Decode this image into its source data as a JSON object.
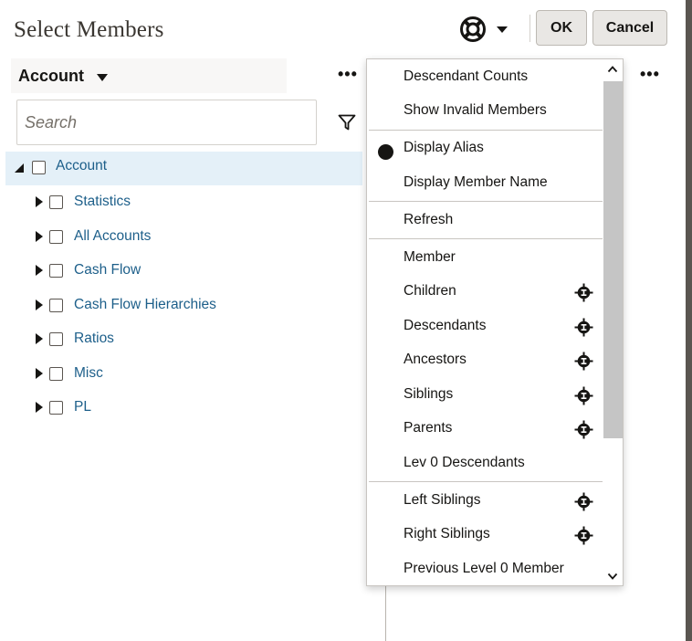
{
  "dialog": {
    "title": "Select Members",
    "ok_label": "OK",
    "cancel_label": "Cancel",
    "help_icon": "lifebuoy-icon"
  },
  "dimension": {
    "selected": "Account"
  },
  "search": {
    "placeholder": "Search",
    "value": ""
  },
  "tree": {
    "root": {
      "label": "Account",
      "expanded": true,
      "checked": false
    },
    "children": [
      {
        "label": "Statistics"
      },
      {
        "label": "All Accounts"
      },
      {
        "label": "Cash Flow"
      },
      {
        "label": "Cash Flow Hierarchies"
      },
      {
        "label": "Ratios"
      },
      {
        "label": "Misc"
      },
      {
        "label": "PL"
      }
    ]
  },
  "menu": {
    "items": [
      {
        "label": "Descendant Counts"
      },
      {
        "label": "Show Invalid Members"
      },
      {
        "label": "Display Alias",
        "selected": true
      },
      {
        "label": "Display Member Name"
      },
      {
        "label": "Refresh"
      },
      {
        "label": "Member"
      },
      {
        "label": "Children",
        "icon": "member-selector-icon"
      },
      {
        "label": "Descendants",
        "icon": "member-selector-icon"
      },
      {
        "label": "Ancestors",
        "icon": "member-selector-icon"
      },
      {
        "label": "Siblings",
        "icon": "member-selector-icon"
      },
      {
        "label": "Parents",
        "icon": "member-selector-icon"
      },
      {
        "label": "Lev 0 Descendants"
      },
      {
        "label": "Left Siblings",
        "icon": "member-selector-icon"
      },
      {
        "label": "Right Siblings",
        "icon": "member-selector-icon"
      },
      {
        "label": "Previous Level 0 Member"
      }
    ]
  },
  "colors": {
    "link": "#1d5f8a",
    "root_highlight": "#e4f0f8",
    "scroll_thumb": "#c5c5c5"
  }
}
